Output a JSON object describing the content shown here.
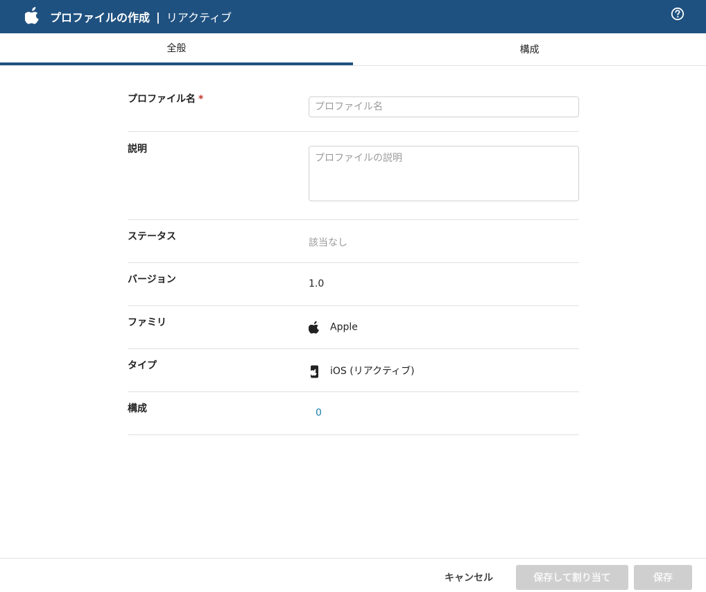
{
  "header": {
    "title_bold": "プロファイルの作成",
    "separator": "|",
    "subtitle": "リアクティブ",
    "logo_icon": "apple-icon",
    "help_icon": "help-circle-icon",
    "bg_color": "#1f5180"
  },
  "tabs": [
    {
      "label": "全般",
      "active": true
    },
    {
      "label": "構成",
      "active": false
    }
  ],
  "form": {
    "profile_name": {
      "label": "プロファイル名",
      "required_mark": "*",
      "placeholder": "プロファイル名",
      "value": ""
    },
    "description": {
      "label": "説明",
      "placeholder": "プロファイルの説明",
      "value": ""
    },
    "status": {
      "label": "ステータス",
      "value": "該当なし"
    },
    "version": {
      "label": "バージョン",
      "value": "1.0"
    },
    "family": {
      "label": "ファミリ",
      "value": "Apple",
      "icon": "apple-icon"
    },
    "type": {
      "label": "タイプ",
      "value": "iOS (リアクティブ)",
      "icon": "phone-icon"
    },
    "config": {
      "label": "構成",
      "value": "0"
    }
  },
  "footer": {
    "cancel_label": "キャンセル",
    "save_assign_label": "保存して割り当て",
    "save_label": "保存"
  }
}
